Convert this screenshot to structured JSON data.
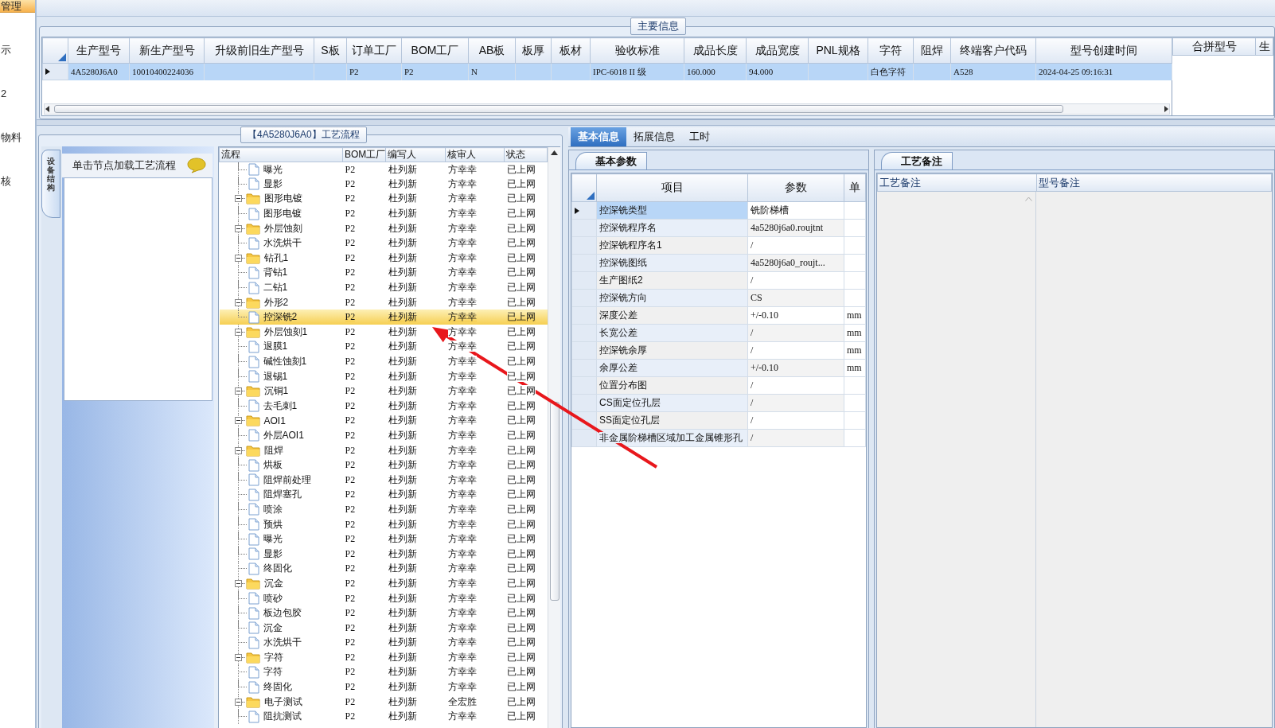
{
  "sidebar": {
    "items": [
      {
        "label": "管理",
        "selected": true
      },
      {
        "label": "示",
        "selected": false
      },
      {
        "label": "2",
        "selected": false
      },
      {
        "label": "物料",
        "selected": false
      },
      {
        "label": "核",
        "selected": false
      }
    ]
  },
  "main_info": {
    "title": "主要信息",
    "table": {
      "row_selected": true,
      "columns": [
        {
          "label": "生产型号",
          "value": "4A5280J6A0"
        },
        {
          "label": "新生产型号",
          "value": "10010400224036"
        },
        {
          "label": "升级前旧生产型号"
        },
        {
          "label": "S板"
        },
        {
          "label": "订单工厂",
          "value": "P2"
        },
        {
          "label": "BOM工厂",
          "value": "P2"
        },
        {
          "label": "AB板",
          "value": "N"
        },
        {
          "label": "板厚"
        },
        {
          "label": "板材"
        },
        {
          "label": "验收标准",
          "value": "IPC-6018 II 级"
        },
        {
          "label": "成品长度",
          "value": "160.000"
        },
        {
          "label": "成品宽度",
          "value": "94.000"
        },
        {
          "label": "PNL规格"
        },
        {
          "label": "字符",
          "value": "白色字符"
        },
        {
          "label": "阻焊"
        },
        {
          "label": "终端客户代码",
          "value": "A528"
        },
        {
          "label": "型号创建时间",
          "value": "2024-04-25 09:16:31"
        }
      ]
    },
    "side_table": {
      "columns": [
        "合拼型号",
        "生"
      ]
    }
  },
  "process_flow": {
    "title": "【4A5280J6A0】工艺流程",
    "side_tab": "设备结构",
    "hint": "单击节点加载工艺流程",
    "tree": {
      "columns": [
        "流程",
        "BOM工厂",
        "编写人",
        "核审人",
        "状态"
      ],
      "nodes": [
        {
          "children": [
            {
              "name": "曝光",
              "kind": "file",
              "bom": "P2",
              "writer": "杜列新",
              "reviewer": "方幸幸",
              "status": "已上网",
              "selected": false
            },
            {
              "name": "显影",
              "kind": "file",
              "bom": "P2",
              "writer": "杜列新",
              "reviewer": "方幸幸",
              "status": "已上网",
              "selected": false
            }
          ]
        },
        {
          "name": "图形电镀",
          "kind": "folder",
          "expanded": true,
          "bom": "P2",
          "writer": "杜列新",
          "reviewer": "方幸幸",
          "status": "已上网",
          "selected": false,
          "children": [
            {
              "name": "图形电镀",
              "kind": "file",
              "bom": "P2",
              "writer": "杜列新",
              "reviewer": "方幸幸",
              "status": "已上网",
              "selected": false
            }
          ]
        },
        {
          "name": "外层蚀刻",
          "kind": "folder",
          "expanded": true,
          "bom": "P2",
          "writer": "杜列新",
          "reviewer": "方幸幸",
          "status": "已上网",
          "selected": false,
          "children": [
            {
              "name": "水洗烘干",
              "kind": "file",
              "bom": "P2",
              "writer": "杜列新",
              "reviewer": "方幸幸",
              "status": "已上网",
              "selected": false
            }
          ]
        },
        {
          "name": "钻孔1",
          "kind": "folder",
          "expanded": true,
          "bom": "P2",
          "writer": "杜列新",
          "reviewer": "方幸幸",
          "status": "已上网",
          "selected": false,
          "children": [
            {
              "name": "背钻1",
              "kind": "file",
              "bom": "P2",
              "writer": "杜列新",
              "reviewer": "方幸幸",
              "status": "已上网",
              "selected": false
            },
            {
              "name": "二钻1",
              "kind": "file",
              "bom": "P2",
              "writer": "杜列新",
              "reviewer": "方幸幸",
              "status": "已上网",
              "selected": false
            }
          ]
        },
        {
          "name": "外形2",
          "kind": "folder",
          "expanded": true,
          "bom": "P2",
          "writer": "杜列新",
          "reviewer": "方幸幸",
          "status": "已上网",
          "selected": false,
          "children": [
            {
              "name": "控深铣2",
              "kind": "file",
              "bom": "P2",
              "writer": "杜列新",
              "reviewer": "方幸幸",
              "status": "已上网",
              "selected": true
            }
          ]
        },
        {
          "name": "外层蚀刻1",
          "kind": "folder",
          "expanded": true,
          "bom": "P2",
          "writer": "杜列新",
          "reviewer": "方幸幸",
          "status": "已上网",
          "selected": false,
          "children": [
            {
              "name": "退膜1",
              "kind": "file",
              "bom": "P2",
              "writer": "杜列新",
              "reviewer": "方幸幸",
              "status": "已上网",
              "selected": false
            },
            {
              "name": "碱性蚀刻1",
              "kind": "file",
              "bom": "P2",
              "writer": "杜列新",
              "reviewer": "方幸幸",
              "status": "已上网",
              "selected": false
            },
            {
              "name": "退锡1",
              "kind": "file",
              "bom": "P2",
              "writer": "杜列新",
              "reviewer": "方幸幸",
              "status": "已上网",
              "selected": false
            }
          ]
        },
        {
          "name": "沉铜1",
          "kind": "folder",
          "expanded": true,
          "bom": "P2",
          "writer": "杜列新",
          "reviewer": "方幸幸",
          "status": "已上网",
          "selected": false,
          "children": [
            {
              "name": "去毛刺1",
              "kind": "file",
              "bom": "P2",
              "writer": "杜列新",
              "reviewer": "方幸幸",
              "status": "已上网",
              "selected": false
            }
          ]
        },
        {
          "name": "AOI1",
          "kind": "folder",
          "expanded": true,
          "bom": "P2",
          "writer": "杜列新",
          "reviewer": "方幸幸",
          "status": "已上网",
          "selected": false,
          "children": [
            {
              "name": "外层AOI1",
              "kind": "file",
              "bom": "P2",
              "writer": "杜列新",
              "reviewer": "方幸幸",
              "status": "已上网",
              "selected": false
            }
          ]
        },
        {
          "name": "阻焊",
          "kind": "folder",
          "expanded": true,
          "bom": "P2",
          "writer": "杜列新",
          "reviewer": "方幸幸",
          "status": "已上网",
          "selected": false,
          "children": [
            {
              "name": "烘板",
              "kind": "file",
              "bom": "P2",
              "writer": "杜列新",
              "reviewer": "方幸幸",
              "status": "已上网",
              "selected": false
            },
            {
              "name": "阻焊前处理",
              "kind": "file",
              "bom": "P2",
              "writer": "杜列新",
              "reviewer": "方幸幸",
              "status": "已上网",
              "selected": false
            },
            {
              "name": "阻焊塞孔",
              "kind": "file",
              "bom": "P2",
              "writer": "杜列新",
              "reviewer": "方幸幸",
              "status": "已上网",
              "selected": false
            },
            {
              "name": "喷涂",
              "kind": "file",
              "bom": "P2",
              "writer": "杜列新",
              "reviewer": "方幸幸",
              "status": "已上网",
              "selected": false
            },
            {
              "name": "预烘",
              "kind": "file",
              "bom": "P2",
              "writer": "杜列新",
              "reviewer": "方幸幸",
              "status": "已上网",
              "selected": false
            },
            {
              "name": "曝光",
              "kind": "file",
              "bom": "P2",
              "writer": "杜列新",
              "reviewer": "方幸幸",
              "status": "已上网",
              "selected": false
            },
            {
              "name": "显影",
              "kind": "file",
              "bom": "P2",
              "writer": "杜列新",
              "reviewer": "方幸幸",
              "status": "已上网",
              "selected": false
            },
            {
              "name": "终固化",
              "kind": "file",
              "bom": "P2",
              "writer": "杜列新",
              "reviewer": "方幸幸",
              "status": "已上网",
              "selected": false
            }
          ]
        },
        {
          "name": "沉金",
          "kind": "folder",
          "expanded": true,
          "bom": "P2",
          "writer": "杜列新",
          "reviewer": "方幸幸",
          "status": "已上网",
          "selected": false,
          "children": [
            {
              "name": "喷砂",
              "kind": "file",
              "bom": "P2",
              "writer": "杜列新",
              "reviewer": "方幸幸",
              "status": "已上网",
              "selected": false
            },
            {
              "name": "板边包胶",
              "kind": "file",
              "bom": "P2",
              "writer": "杜列新",
              "reviewer": "方幸幸",
              "status": "已上网",
              "selected": false
            },
            {
              "name": "沉金",
              "kind": "file",
              "bom": "P2",
              "writer": "杜列新",
              "reviewer": "方幸幸",
              "status": "已上网",
              "selected": false
            },
            {
              "name": "水洗烘干",
              "kind": "file",
              "bom": "P2",
              "writer": "杜列新",
              "reviewer": "方幸幸",
              "status": "已上网",
              "selected": false
            }
          ]
        },
        {
          "name": "字符",
          "kind": "folder",
          "expanded": true,
          "bom": "P2",
          "writer": "杜列新",
          "reviewer": "方幸幸",
          "status": "已上网",
          "selected": false,
          "children": [
            {
              "name": "字符",
              "kind": "file",
              "bom": "P2",
              "writer": "杜列新",
              "reviewer": "方幸幸",
              "status": "已上网",
              "selected": false
            },
            {
              "name": "终固化",
              "kind": "file",
              "bom": "P2",
              "writer": "杜列新",
              "reviewer": "方幸幸",
              "status": "已上网",
              "selected": false
            }
          ]
        },
        {
          "name": "电子测试",
          "kind": "folder",
          "expanded": true,
          "bom": "P2",
          "writer": "杜列新",
          "reviewer": "全宏胜",
          "status": "已上网",
          "selected": false,
          "children": [
            {
              "name": "阻抗测试",
              "kind": "file",
              "bom": "P2",
              "writer": "杜列新",
              "reviewer": "方幸幸",
              "status": "已上网",
              "selected": false
            }
          ]
        }
      ]
    }
  },
  "details": {
    "tabs": [
      {
        "label": "基本信息",
        "selected": true
      },
      {
        "label": "拓展信息",
        "selected": false
      },
      {
        "label": "工时",
        "selected": false
      }
    ],
    "params": {
      "tab": "基本参数",
      "columns": [
        "项目",
        "参数",
        "单"
      ],
      "rows": [
        {
          "item": "控深铣类型",
          "value": "铣阶梯槽",
          "selected": true
        },
        {
          "item": "控深铣程序名",
          "value": "4a5280j6a0.roujtnt",
          "selected": false
        },
        {
          "item": "控深铣程序名1",
          "value": "/",
          "selected": false
        },
        {
          "item": "控深铣图纸",
          "value": "4a5280j6a0_roujt...",
          "selected": false
        },
        {
          "item": "生产图纸2",
          "value": "/",
          "selected": false
        },
        {
          "item": "控深铣方向",
          "value": "CS",
          "selected": false
        },
        {
          "item": "深度公差",
          "value": "+/-0.10",
          "unit": "mm",
          "selected": false
        },
        {
          "item": "长宽公差",
          "value": "/",
          "unit": "mm",
          "selected": false
        },
        {
          "item": "控深铣余厚",
          "value": "/",
          "unit": "mm",
          "selected": false
        },
        {
          "item": "余厚公差",
          "value": "+/-0.10",
          "unit": "mm",
          "selected": false
        },
        {
          "item": "位置分布图",
          "value": "/",
          "selected": false
        },
        {
          "item": "CS面定位孔层",
          "value": "/",
          "selected": false
        },
        {
          "item": "SS面定位孔层",
          "value": "/",
          "selected": false
        },
        {
          "item": "非金属阶梯槽区域加工金属锥形孔",
          "value": "/",
          "selected": false
        }
      ]
    },
    "notes": {
      "tab": "工艺备注",
      "columns": [
        "工艺备注",
        "型号备注"
      ]
    }
  }
}
